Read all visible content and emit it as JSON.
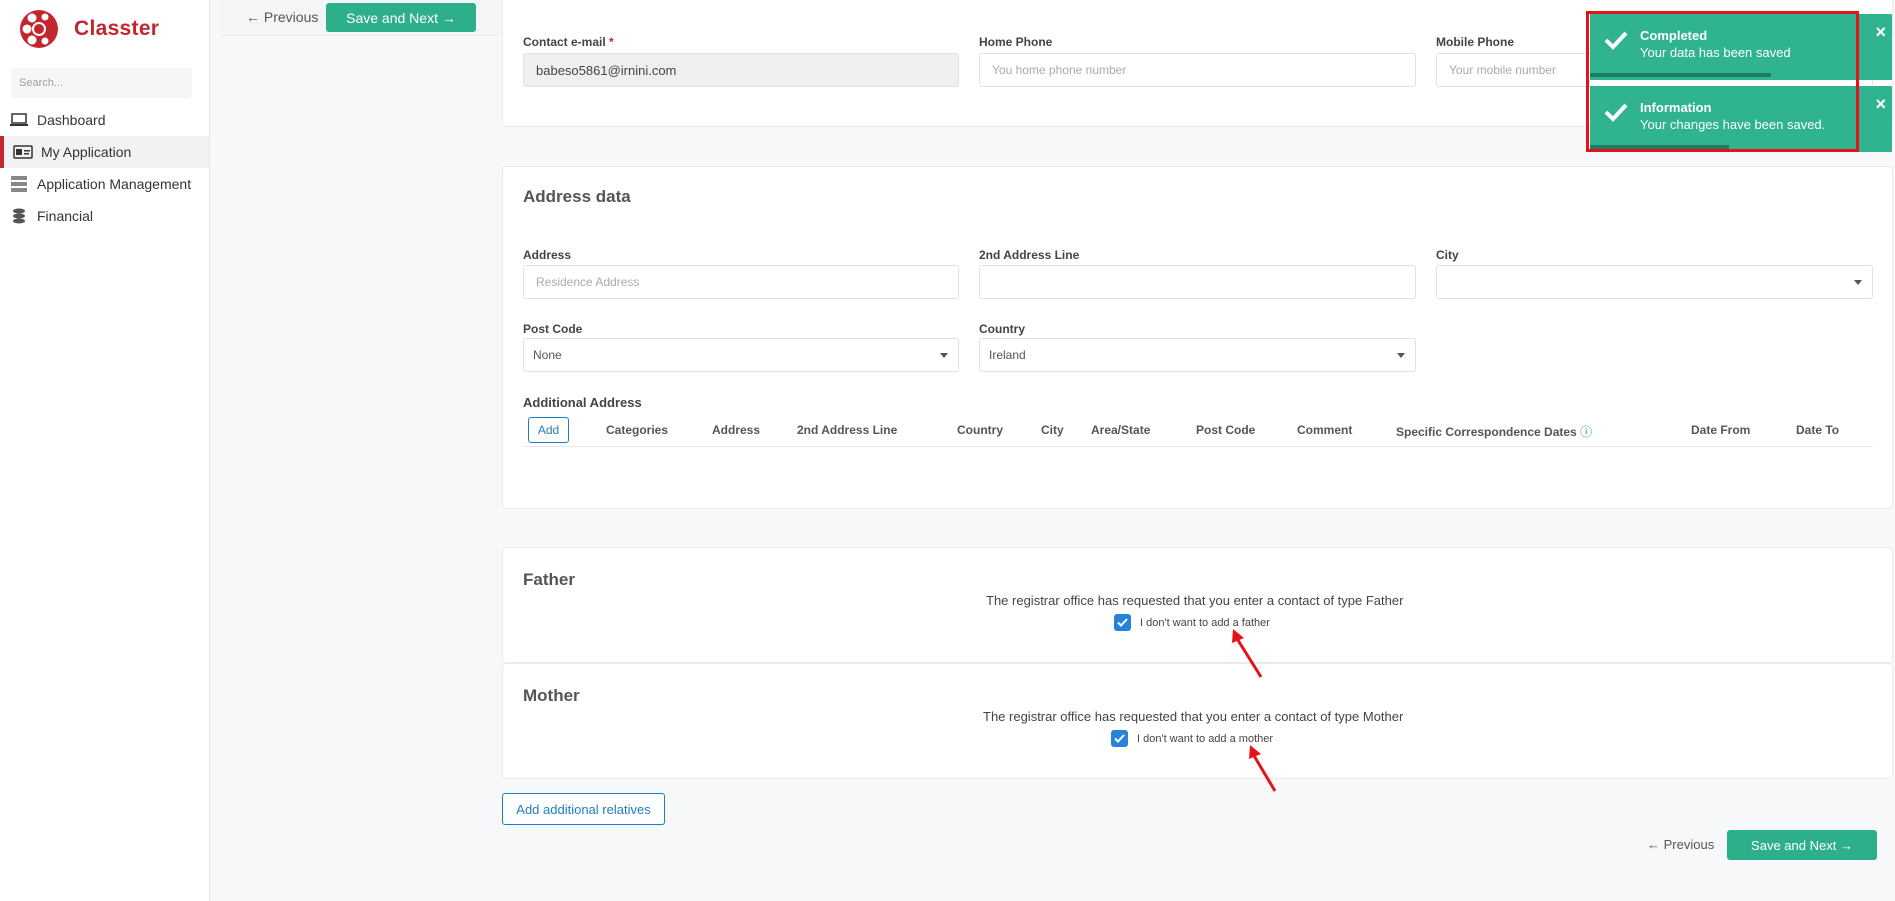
{
  "app": {
    "name": "Classter"
  },
  "search": {
    "placeholder": "Search..."
  },
  "sidebar": {
    "items": [
      {
        "label": "Dashboard",
        "icon": "laptop-icon",
        "active": false
      },
      {
        "label": "My Application",
        "icon": "id-card-icon",
        "active": true
      },
      {
        "label": "Application Management",
        "icon": "server-icon",
        "active": false
      },
      {
        "label": "Financial",
        "icon": "coins-icon",
        "active": false
      }
    ]
  },
  "toolbar": {
    "previous_label": "Previous",
    "save_next_label": "Save and Next"
  },
  "contact": {
    "email_label": "Contact e-mail",
    "email_required_mark": "*",
    "email_value": "babeso5861@irnini.com",
    "home_phone_label": "Home Phone",
    "home_phone_placeholder": "You home phone number",
    "mobile_phone_label": "Mobile Phone",
    "mobile_phone_placeholder": "Your mobile number"
  },
  "address": {
    "title": "Address data",
    "address_label": "Address",
    "address_placeholder": "Residence Address",
    "line2_label": "2nd Address Line",
    "city_label": "City",
    "post_code_label": "Post Code",
    "post_code_value": "None",
    "country_label": "Country",
    "country_value": "Ireland",
    "additional_title": "Additional Address",
    "add_label": "Add",
    "columns": [
      "Categories",
      "Address",
      "2nd Address Line",
      "Country",
      "City",
      "Area/State",
      "Post Code",
      "Comment",
      "Specific Correspondence Dates",
      "Date From",
      "Date To"
    ]
  },
  "father": {
    "title": "Father",
    "message": "The registrar office has requested that you enter a contact of type Father",
    "checkbox_label": "I don't want to add a father",
    "checked": true
  },
  "mother": {
    "title": "Mother",
    "message": "The registrar office has requested that you enter a contact of type Mother",
    "checkbox_label": "I don't want to add a mother",
    "checked": true
  },
  "relatives": {
    "add_label": "Add additional relatives"
  },
  "footer": {
    "previous_label": "Previous",
    "save_next_label": "Save and Next"
  },
  "toasts": [
    {
      "title": "Completed",
      "message": "Your data has been saved",
      "progress": 0.6
    },
    {
      "title": "Information",
      "message": "Your changes have been saved.",
      "progress": 0.46
    }
  ],
  "colors": {
    "brand": "#c4262e",
    "accent": "#2eaf8c",
    "link": "#1f7ec2",
    "toast": "#2fb391",
    "highlight": "#e3121b"
  }
}
